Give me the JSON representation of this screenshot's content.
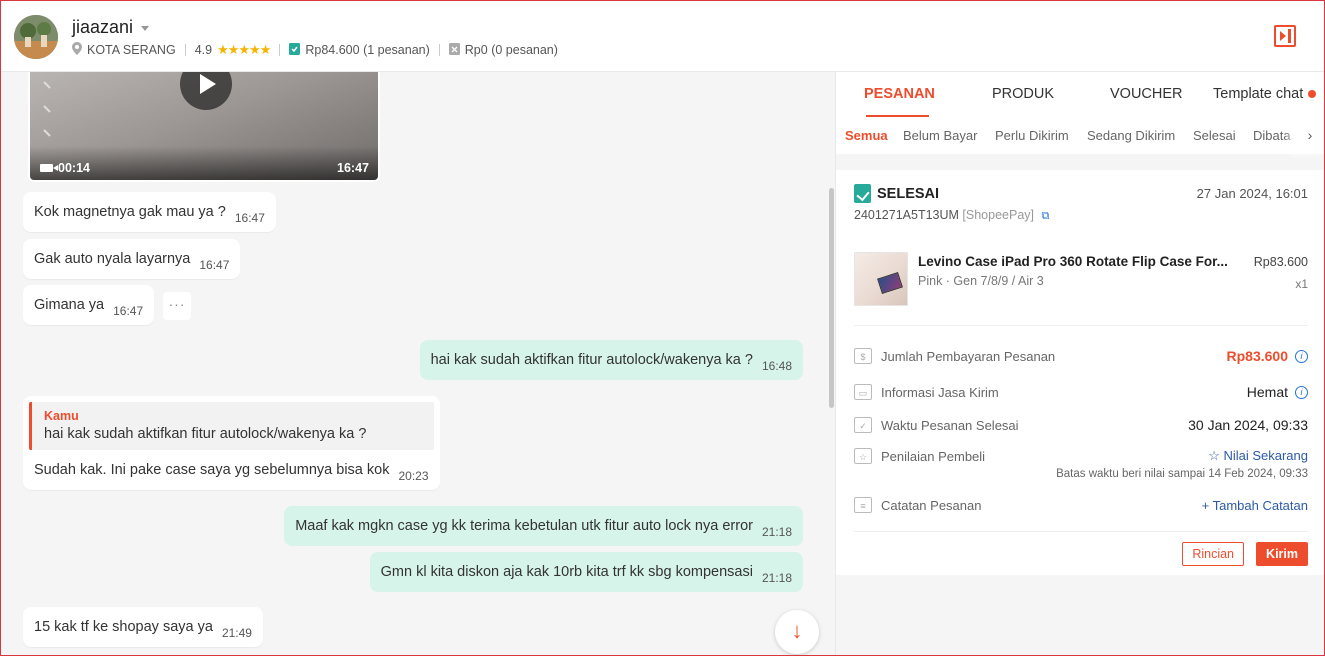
{
  "header": {
    "username": "jiaazani",
    "location": "KOTA SERANG",
    "rating": "4.9",
    "stars": "★★★★★",
    "paid_amount": "Rp84.600",
    "paid_orders": "(1 pesanan)",
    "unpaid_amount": "Rp0",
    "unpaid_orders": "(0 pesanan)"
  },
  "chat": {
    "video": {
      "duration": "00:14",
      "time": "16:47"
    },
    "messages": [
      {
        "text": "Kok magnetnya gak mau ya ?",
        "time": "16:47"
      },
      {
        "text": "Gak auto nyala layarnya",
        "time": "16:47"
      },
      {
        "text": "Gimana ya",
        "time": "16:47"
      },
      {
        "text": "hai kak sudah aktifkan fitur autolock/wakenya ka ?",
        "time": "16:48"
      },
      {
        "text": "Sudah kak. Ini pake case saya yg sebelumnya bisa kok",
        "time": "20:23",
        "quote_author": "Kamu",
        "quote_text": "hai kak sudah aktifkan fitur autolock/wakenya ka ?"
      },
      {
        "text": "Maaf kak mgkn case yg kk terima kebetulan utk fitur auto lock nya error",
        "time": "21:18"
      },
      {
        "text": "Gmn kl kita diskon aja kak 10rb kita trf kk sbg kompensasi",
        "time": "21:18"
      },
      {
        "text": "15 kak tf ke shopay saya ya",
        "time": "21:49"
      }
    ],
    "more_label": "···",
    "scroll_down_label": "↓"
  },
  "panel": {
    "tabs": [
      "PESANAN",
      "PRODUK",
      "VOUCHER",
      "Template chat"
    ],
    "subtabs": [
      "Semua",
      "Belum Bayar",
      "Perlu Dikirim",
      "Sedang Dikirim",
      "Selesai",
      "Dibata"
    ],
    "subtab_next": "›",
    "order": {
      "status": "SELESAI",
      "date": "27 Jan 2024, 16:01",
      "id": "2401271A5T13UM",
      "payment": "[ShopeePay]",
      "product_name": "Levino Case iPad Pro 360 Rotate Flip Case For...",
      "variation": "Pink · Gen 7/8/9 / Air 3",
      "price": "Rp83.600",
      "qty": "x1",
      "rows": {
        "total_label": "Jumlah Pembayaran Pesanan",
        "total_value": "Rp83.600",
        "shipping_label": "Informasi Jasa Kirim",
        "shipping_value": "Hemat",
        "completed_label": "Waktu Pesanan Selesai",
        "completed_value": "30 Jan 2024, 09:33",
        "review_label": "Penilaian Pembeli",
        "review_value": "☆ Nilai Sekarang",
        "review_deadline": "Batas waktu beri nilai sampai 14 Feb 2024, 09:33",
        "note_label": "Catatan Pesanan",
        "note_value": "+ Tambah Catatan"
      },
      "btn_detail": "Rincian",
      "btn_send": "Kirim"
    }
  },
  "colors": {
    "accent": "#ee4d2d",
    "outgoing_bubble": "#d7f4ea",
    "success": "#26aa99",
    "link": "#2d5aa8"
  }
}
